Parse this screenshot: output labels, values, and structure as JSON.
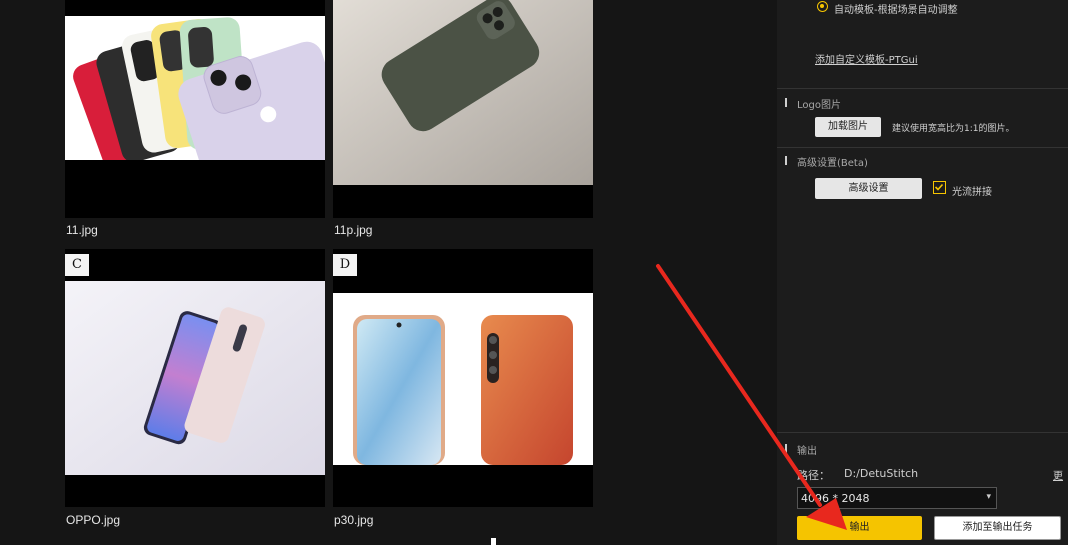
{
  "gallery": {
    "items": [
      {
        "letter": "",
        "filename": "11.jpg"
      },
      {
        "letter": "",
        "filename": "11p.jpg"
      },
      {
        "letter": "C",
        "filename": "OPPO.jpg"
      },
      {
        "letter": "D",
        "filename": "p30.jpg"
      }
    ]
  },
  "panel": {
    "template": {
      "auto_option": "自动模板-根据场景自动调整",
      "custom_link": "添加自定义模板-PTGui"
    },
    "logo": {
      "heading": "Logo图片",
      "load_button": "加载图片",
      "hint": "建议使用宽高比为1:1的图片。"
    },
    "advanced": {
      "heading": "高级设置(Beta)",
      "settings_button": "高级设置",
      "optical_flow_label": "光流拼接",
      "optical_flow_checked": true
    },
    "output": {
      "heading": "输出",
      "path_label": "路径：",
      "path_value": "D:/DetuStitch",
      "change_link": "更",
      "resolution": "4096 * 2048",
      "export_button": "输出",
      "add_task_button": "添加至输出任务"
    }
  },
  "colors": {
    "accent": "#f5c400",
    "arrow": "#e8281e",
    "background": "#151515",
    "panel": "#1c1c1c"
  }
}
